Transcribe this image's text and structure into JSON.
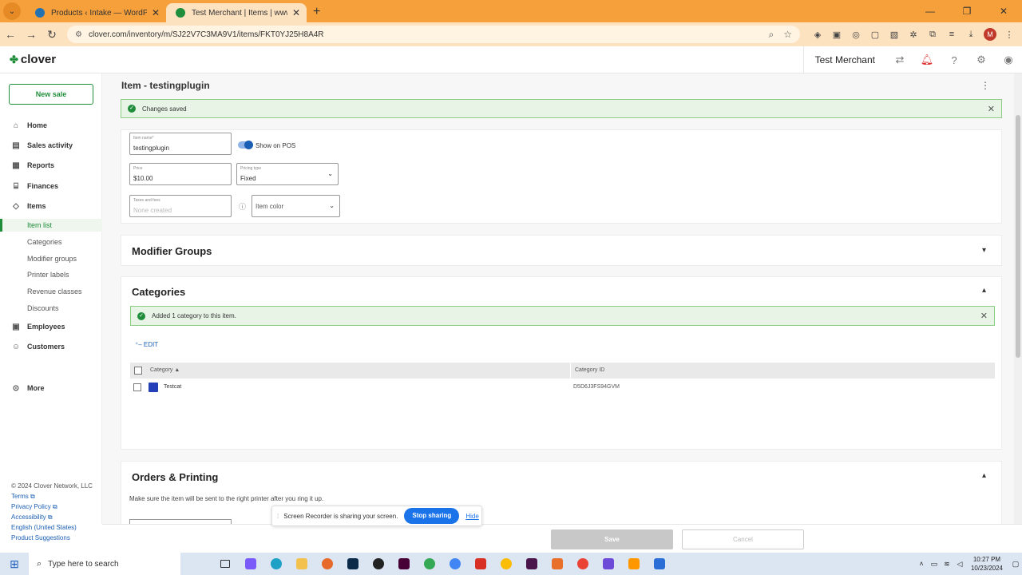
{
  "browser": {
    "tabs": [
      {
        "title": "Products ‹ Intake — WordPress",
        "color": "#2271b1"
      },
      {
        "title": "Test Merchant | Items | www.clover.com",
        "color": "#1f8d3a"
      }
    ],
    "url": "clover.com/inventory/m/SJ22V7C3MA9V1/items/FKT0YJ25H8A4R",
    "profile_initial": "M"
  },
  "header": {
    "logo_text": "clover",
    "merchant": "Test Merchant"
  },
  "sidebar": {
    "new_sale": "New sale",
    "nav": [
      {
        "label": "Home",
        "icon": "home-icon",
        "glyph": "⌂"
      },
      {
        "label": "Sales activity",
        "icon": "receipt-icon",
        "glyph": "▤"
      },
      {
        "label": "Reports",
        "icon": "reports-icon",
        "glyph": "▦"
      },
      {
        "label": "Finances",
        "icon": "bank-icon",
        "glyph": "⌸"
      },
      {
        "label": "Items",
        "icon": "tag-icon",
        "glyph": "◇"
      }
    ],
    "sub": [
      "Item list",
      "Categories",
      "Modifier groups",
      "Printer labels",
      "Revenue classes",
      "Discounts"
    ],
    "nav2": [
      {
        "label": "Employees",
        "icon": "employees-icon",
        "glyph": "▣"
      },
      {
        "label": "Customers",
        "icon": "customers-icon",
        "glyph": "☺"
      },
      {
        "label": "More",
        "icon": "more-icon",
        "glyph": "⊙"
      }
    ],
    "footer": {
      "copyright": "© 2024 Clover Network, LLC",
      "links": [
        "Terms",
        "Privacy Policy",
        "Accessibility",
        "English (United States)",
        "Product Suggestions"
      ]
    }
  },
  "page": {
    "title": "Item - testingplugin",
    "saved_banner": "Changes saved",
    "item_name_label": "Item name*",
    "item_name": "testingplugin",
    "show_on_pos": "Show on POS",
    "price_label": "Price",
    "price": "$10.00",
    "pricing_type_label": "Pricing type",
    "pricing_type": "Fixed",
    "taxes_label": "Taxes and fees",
    "taxes_placeholder": "None created",
    "item_color": "Item color"
  },
  "modifier_groups": {
    "title": "Modifier Groups"
  },
  "categories": {
    "title": "Categories",
    "banner": "Added 1 category to this item.",
    "edit": "EDIT",
    "columns": [
      "Category",
      "Category ID"
    ],
    "rows": [
      {
        "name": "Testcat",
        "id": "D5D6J3FS94GVM",
        "color": "#2440b8"
      }
    ]
  },
  "orders": {
    "title": "Orders & Printing",
    "description": "Make sure the item will be sent to the right printer after you ring it up."
  },
  "actions": {
    "save": "Save",
    "cancel": "Cancel"
  },
  "screen_share": {
    "message": "Screen Recorder is sharing your screen.",
    "stop": "Stop sharing",
    "hide": "Hide"
  },
  "taskbar": {
    "search_placeholder": "Type here to search",
    "time": "10:27 PM",
    "date": "10/23/2024"
  }
}
